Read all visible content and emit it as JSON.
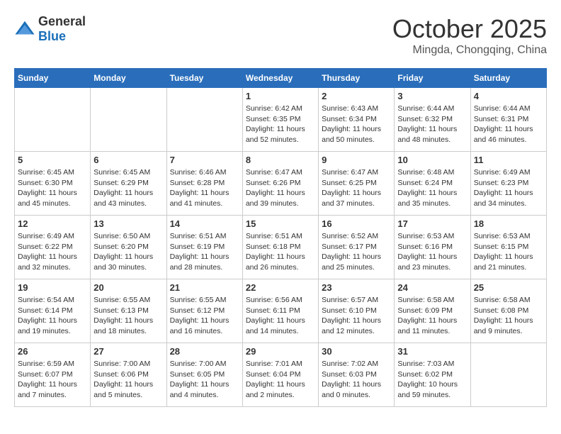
{
  "logo": {
    "text_general": "General",
    "text_blue": "Blue"
  },
  "header": {
    "month": "October 2025",
    "location": "Mingda, Chongqing, China"
  },
  "days_of_week": [
    "Sunday",
    "Monday",
    "Tuesday",
    "Wednesday",
    "Thursday",
    "Friday",
    "Saturday"
  ],
  "weeks": [
    [
      {
        "day": "",
        "info": ""
      },
      {
        "day": "",
        "info": ""
      },
      {
        "day": "",
        "info": ""
      },
      {
        "day": "1",
        "info": "Sunrise: 6:42 AM\nSunset: 6:35 PM\nDaylight: 11 hours\nand 52 minutes."
      },
      {
        "day": "2",
        "info": "Sunrise: 6:43 AM\nSunset: 6:34 PM\nDaylight: 11 hours\nand 50 minutes."
      },
      {
        "day": "3",
        "info": "Sunrise: 6:44 AM\nSunset: 6:32 PM\nDaylight: 11 hours\nand 48 minutes."
      },
      {
        "day": "4",
        "info": "Sunrise: 6:44 AM\nSunset: 6:31 PM\nDaylight: 11 hours\nand 46 minutes."
      }
    ],
    [
      {
        "day": "5",
        "info": "Sunrise: 6:45 AM\nSunset: 6:30 PM\nDaylight: 11 hours\nand 45 minutes."
      },
      {
        "day": "6",
        "info": "Sunrise: 6:45 AM\nSunset: 6:29 PM\nDaylight: 11 hours\nand 43 minutes."
      },
      {
        "day": "7",
        "info": "Sunrise: 6:46 AM\nSunset: 6:28 PM\nDaylight: 11 hours\nand 41 minutes."
      },
      {
        "day": "8",
        "info": "Sunrise: 6:47 AM\nSunset: 6:26 PM\nDaylight: 11 hours\nand 39 minutes."
      },
      {
        "day": "9",
        "info": "Sunrise: 6:47 AM\nSunset: 6:25 PM\nDaylight: 11 hours\nand 37 minutes."
      },
      {
        "day": "10",
        "info": "Sunrise: 6:48 AM\nSunset: 6:24 PM\nDaylight: 11 hours\nand 35 minutes."
      },
      {
        "day": "11",
        "info": "Sunrise: 6:49 AM\nSunset: 6:23 PM\nDaylight: 11 hours\nand 34 minutes."
      }
    ],
    [
      {
        "day": "12",
        "info": "Sunrise: 6:49 AM\nSunset: 6:22 PM\nDaylight: 11 hours\nand 32 minutes."
      },
      {
        "day": "13",
        "info": "Sunrise: 6:50 AM\nSunset: 6:20 PM\nDaylight: 11 hours\nand 30 minutes."
      },
      {
        "day": "14",
        "info": "Sunrise: 6:51 AM\nSunset: 6:19 PM\nDaylight: 11 hours\nand 28 minutes."
      },
      {
        "day": "15",
        "info": "Sunrise: 6:51 AM\nSunset: 6:18 PM\nDaylight: 11 hours\nand 26 minutes."
      },
      {
        "day": "16",
        "info": "Sunrise: 6:52 AM\nSunset: 6:17 PM\nDaylight: 11 hours\nand 25 minutes."
      },
      {
        "day": "17",
        "info": "Sunrise: 6:53 AM\nSunset: 6:16 PM\nDaylight: 11 hours\nand 23 minutes."
      },
      {
        "day": "18",
        "info": "Sunrise: 6:53 AM\nSunset: 6:15 PM\nDaylight: 11 hours\nand 21 minutes."
      }
    ],
    [
      {
        "day": "19",
        "info": "Sunrise: 6:54 AM\nSunset: 6:14 PM\nDaylight: 11 hours\nand 19 minutes."
      },
      {
        "day": "20",
        "info": "Sunrise: 6:55 AM\nSunset: 6:13 PM\nDaylight: 11 hours\nand 18 minutes."
      },
      {
        "day": "21",
        "info": "Sunrise: 6:55 AM\nSunset: 6:12 PM\nDaylight: 11 hours\nand 16 minutes."
      },
      {
        "day": "22",
        "info": "Sunrise: 6:56 AM\nSunset: 6:11 PM\nDaylight: 11 hours\nand 14 minutes."
      },
      {
        "day": "23",
        "info": "Sunrise: 6:57 AM\nSunset: 6:10 PM\nDaylight: 11 hours\nand 12 minutes."
      },
      {
        "day": "24",
        "info": "Sunrise: 6:58 AM\nSunset: 6:09 PM\nDaylight: 11 hours\nand 11 minutes."
      },
      {
        "day": "25",
        "info": "Sunrise: 6:58 AM\nSunset: 6:08 PM\nDaylight: 11 hours\nand 9 minutes."
      }
    ],
    [
      {
        "day": "26",
        "info": "Sunrise: 6:59 AM\nSunset: 6:07 PM\nDaylight: 11 hours\nand 7 minutes."
      },
      {
        "day": "27",
        "info": "Sunrise: 7:00 AM\nSunset: 6:06 PM\nDaylight: 11 hours\nand 5 minutes."
      },
      {
        "day": "28",
        "info": "Sunrise: 7:00 AM\nSunset: 6:05 PM\nDaylight: 11 hours\nand 4 minutes."
      },
      {
        "day": "29",
        "info": "Sunrise: 7:01 AM\nSunset: 6:04 PM\nDaylight: 11 hours\nand 2 minutes."
      },
      {
        "day": "30",
        "info": "Sunrise: 7:02 AM\nSunset: 6:03 PM\nDaylight: 11 hours\nand 0 minutes."
      },
      {
        "day": "31",
        "info": "Sunrise: 7:03 AM\nSunset: 6:02 PM\nDaylight: 10 hours\nand 59 minutes."
      },
      {
        "day": "",
        "info": ""
      }
    ]
  ]
}
